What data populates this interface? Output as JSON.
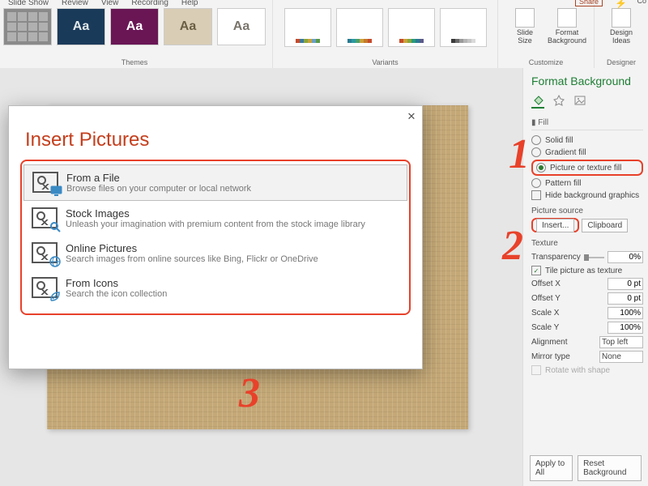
{
  "ribbon": {
    "tabs": [
      "Slide Show",
      "Review",
      "View",
      "Recording",
      "Help"
    ],
    "share": "Share",
    "co": "Co",
    "themes_label": "Themes",
    "theme_tiles": [
      {
        "bg": "#8a8a8a",
        "fg": "#fff",
        "txt": ""
      },
      {
        "bg": "#1a3a5a",
        "fg": "#e0e8ea",
        "txt": "Aa"
      },
      {
        "bg": "#6a1655",
        "fg": "#fff",
        "txt": "Aa"
      },
      {
        "bg": "#d9cdb6",
        "fg": "#6b5f44",
        "txt": "Aa"
      },
      {
        "bg": "#ffffff",
        "fg": "#7a756c",
        "txt": "Aa"
      }
    ],
    "variants_label": "Variants",
    "variants": [
      [
        "#c64b2a",
        "#3a7aa0",
        "#8aa63a",
        "#caa23a",
        "#6aa0c6",
        "#5a9a4a"
      ],
      [
        "#2a7a92",
        "#2a9aa0",
        "#4aa06a",
        "#caa23a",
        "#c67a2a",
        "#c64b2a"
      ],
      [
        "#c64b2a",
        "#caa23a",
        "#8aa63a",
        "#2a9a7a",
        "#2a7a92",
        "#5a5a8a"
      ],
      [
        "#3a3a3a",
        "#6a6a6a",
        "#9a9a9a",
        "#b5b5b5",
        "#c6c6c6",
        "#dadada"
      ]
    ],
    "customize_label": "Customize",
    "designer_label": "Designer",
    "slide_size": "Slide\nSize",
    "format_bg": "Format\nBackground",
    "design_ideas": "Design\nIdeas"
  },
  "dialog": {
    "title": "Insert Pictures",
    "items": [
      {
        "title": "From a File",
        "desc": "Browse files on your computer or local network",
        "badge": "monitor",
        "sel": true
      },
      {
        "title": "Stock Images",
        "desc": "Unleash your imagination with premium content from the stock image library",
        "badge": "search"
      },
      {
        "title": "Online Pictures",
        "desc": "Search images from online sources like Bing, Flickr or OneDrive",
        "badge": "globe"
      },
      {
        "title": "From Icons",
        "desc": "Search the icon collection",
        "badge": "leaf"
      }
    ]
  },
  "panel": {
    "title": "Format Background",
    "section_fill": "Fill",
    "fill_opts": {
      "solid": "Solid fill",
      "gradient": "Gradient fill",
      "picture": "Picture or texture fill",
      "pattern": "Pattern fill"
    },
    "hide_bg": "Hide background graphics",
    "pic_src_label": "Picture source",
    "insert_btn": "Insert...",
    "clipboard_btn": "Clipboard",
    "texture_label": "Texture",
    "transparency_label": "Transparency",
    "transparency_val": "0%",
    "tile_label": "Tile picture as texture",
    "offset_x": "Offset X",
    "offset_x_val": "0 pt",
    "offset_y": "Offset Y",
    "offset_y_val": "0 pt",
    "scale_x": "Scale X",
    "scale_x_val": "100%",
    "scale_y": "Scale Y",
    "scale_y_val": "100%",
    "alignment": "Alignment",
    "alignment_val": "Top left",
    "mirror": "Mirror type",
    "mirror_val": "None",
    "rotate": "Rotate with shape",
    "apply_all": "Apply to All",
    "reset": "Reset Background"
  },
  "annot": {
    "a1": "1",
    "a2": "2",
    "a3": "3"
  }
}
